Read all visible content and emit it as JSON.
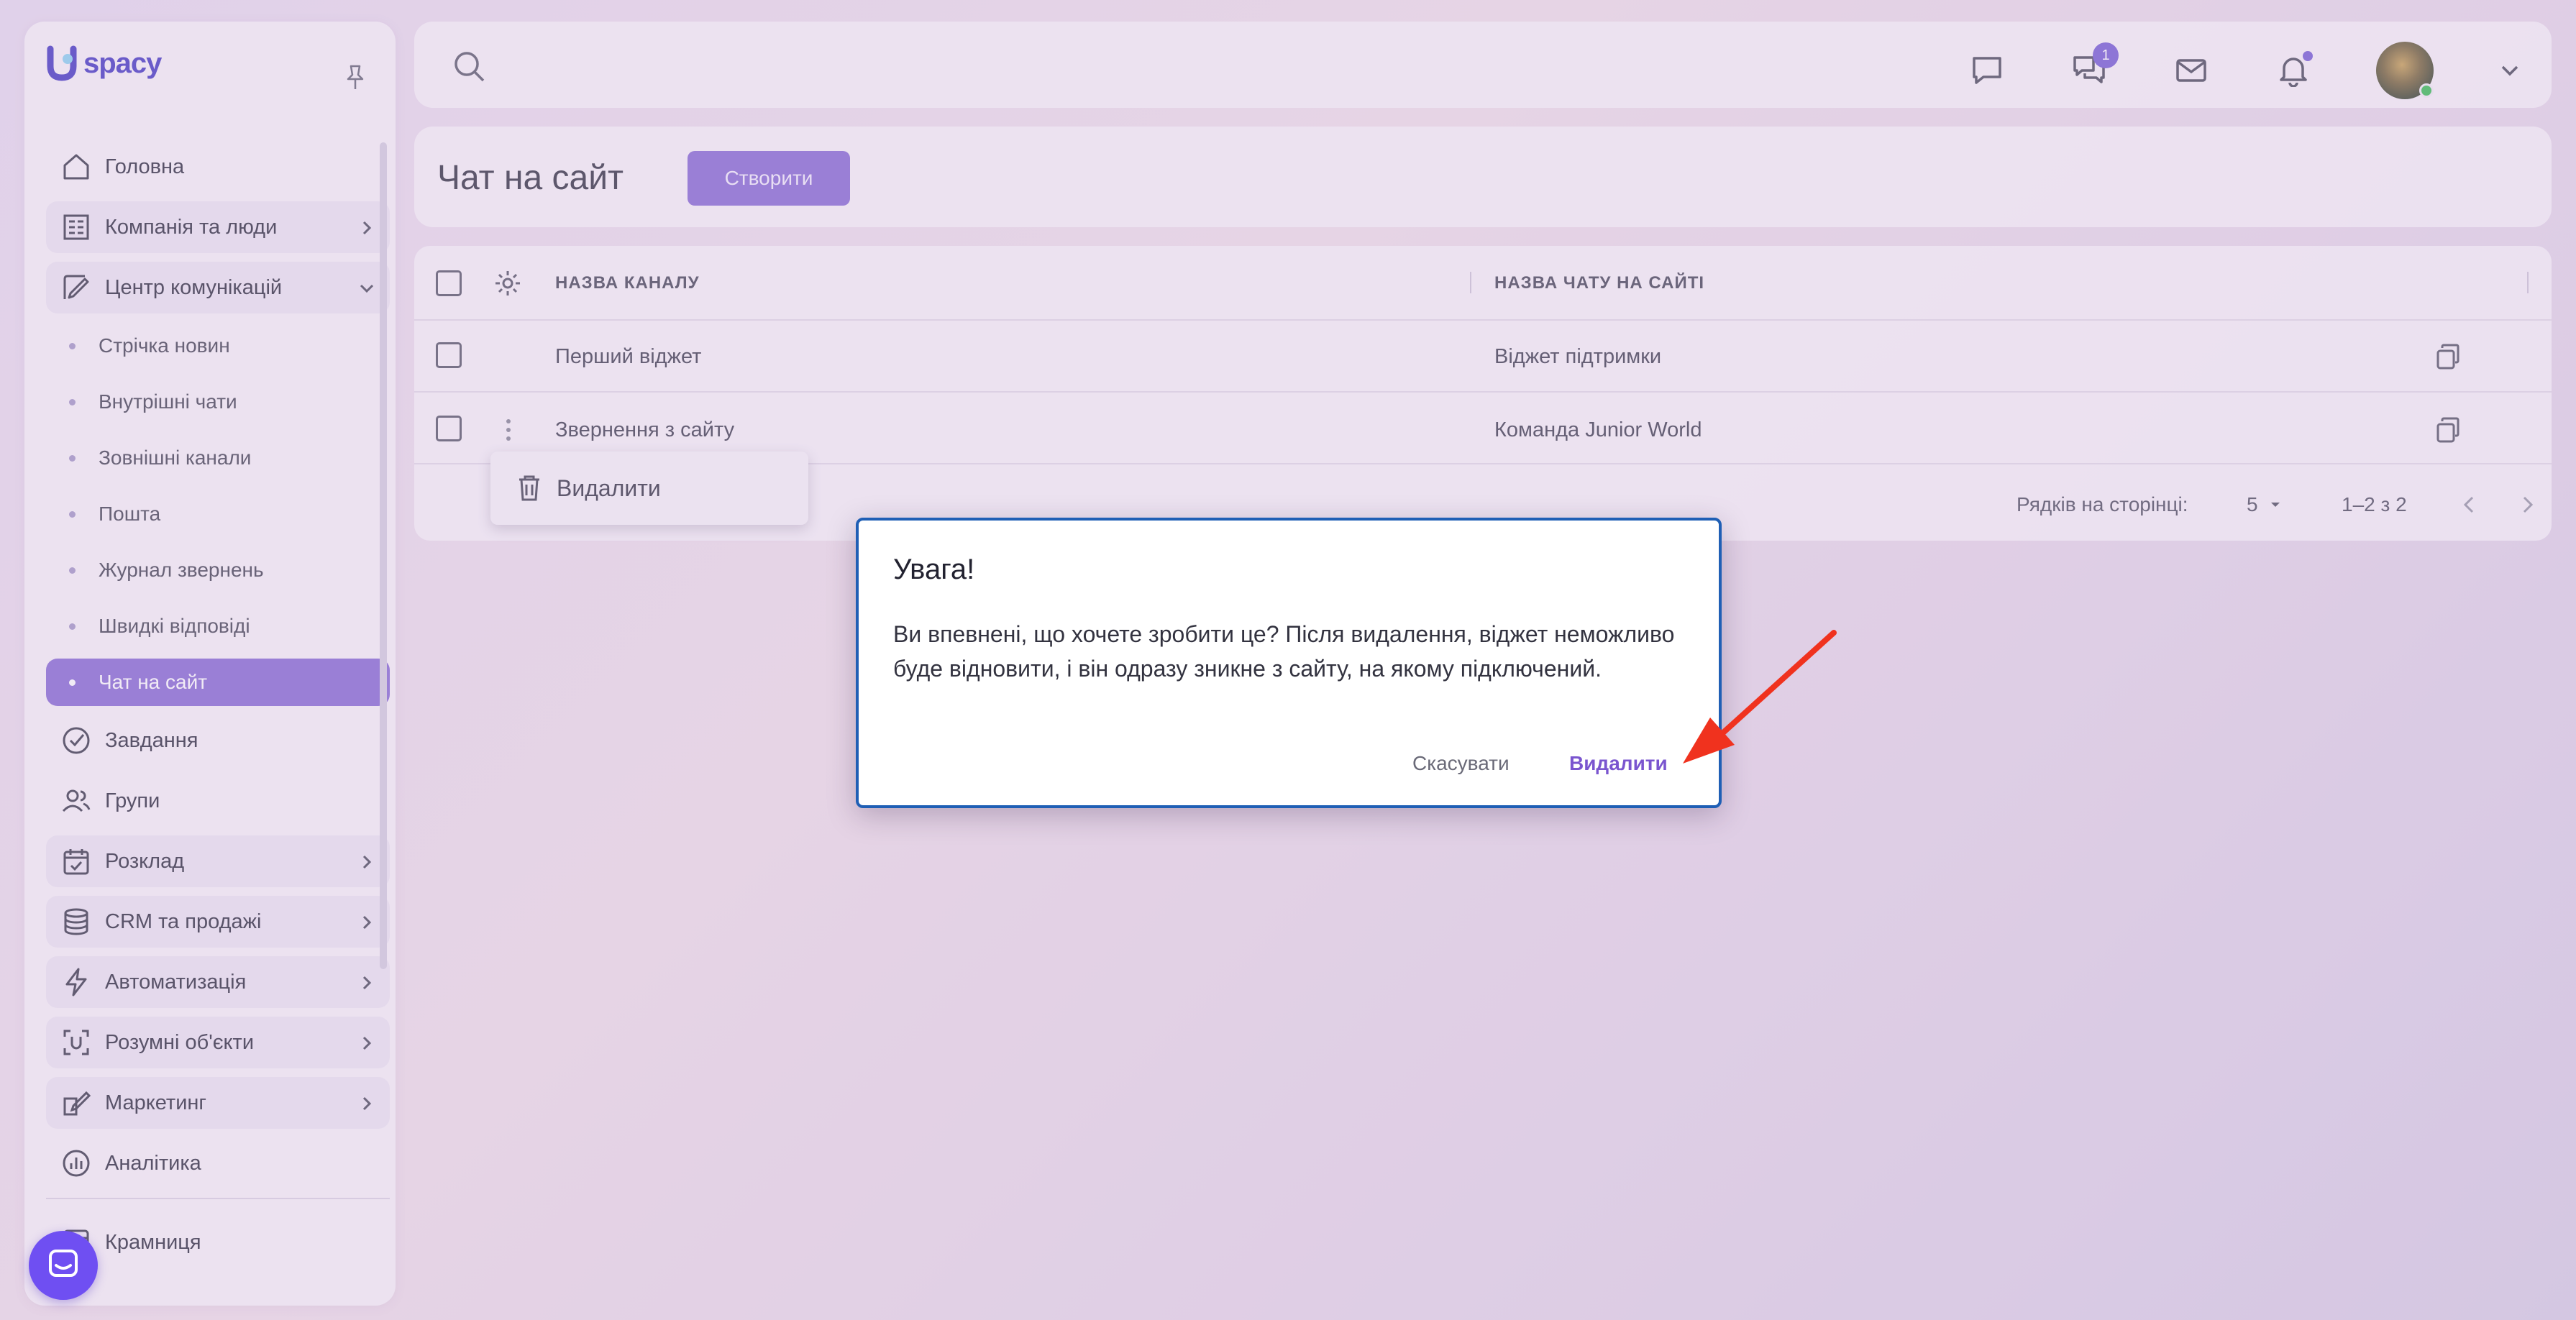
{
  "app": {
    "logo_text": "spacy",
    "brand_color": "#4b3fc5",
    "accent_color": "#8b6fd6"
  },
  "sidebar": {
    "items": [
      {
        "label": "Головна",
        "icon": "home-icon",
        "expandable": false
      },
      {
        "label": "Компанія та люди",
        "icon": "building-icon",
        "expandable": true
      },
      {
        "label": "Центр комунікацій",
        "icon": "communications-icon",
        "expandable": true,
        "expanded": true
      },
      {
        "label": "Завдання",
        "icon": "task-check-icon",
        "expandable": false
      },
      {
        "label": "Групи",
        "icon": "groups-icon",
        "expandable": false
      },
      {
        "label": "Розклад",
        "icon": "calendar-icon",
        "expandable": true
      },
      {
        "label": "CRM та продажі",
        "icon": "database-icon",
        "expandable": true
      },
      {
        "label": "Автоматизація",
        "icon": "lightning-icon",
        "expandable": true
      },
      {
        "label": "Розумні об'єкти",
        "icon": "smart-object-icon",
        "expandable": true
      },
      {
        "label": "Маркетинг",
        "icon": "marketing-icon",
        "expandable": true
      },
      {
        "label": "Аналітика",
        "icon": "analytics-icon",
        "expandable": false
      },
      {
        "label": "Крамниця",
        "icon": "store-icon",
        "expandable": false
      }
    ],
    "sub_items": [
      {
        "label": "Стрічка новин",
        "active": false
      },
      {
        "label": "Внутрішні чати",
        "active": false
      },
      {
        "label": "Зовнішні канали",
        "active": false
      },
      {
        "label": "Пошта",
        "active": false
      },
      {
        "label": "Журнал звернень",
        "active": false
      },
      {
        "label": "Швидкі відповіді",
        "active": false
      },
      {
        "label": "Чат на сайт",
        "active": true
      }
    ]
  },
  "topbar": {
    "chat_badge": "1"
  },
  "page": {
    "title": "Чат на сайт",
    "create_label": "Створити"
  },
  "table": {
    "columns": [
      "НАЗВА КАНАЛУ",
      "НАЗВА ЧАТУ НА САЙТІ"
    ],
    "rows": [
      {
        "channel": "Перший віджет",
        "chat": "Віджет підтримки"
      },
      {
        "channel": "Звернення з сайту",
        "chat": "Команда Junior World"
      }
    ],
    "pager": {
      "rows_label": "Рядків на сторінці:",
      "rows_value": "5",
      "range": "1–2 з 2"
    }
  },
  "context_menu": {
    "delete_label": "Видалити"
  },
  "dialog": {
    "title": "Увага!",
    "message": "Ви впевнені, що хочете зробити це? Після видалення, віджет неможливо буде відновити, і він одразу зникне з сайту, на якому підключений.",
    "cancel_label": "Скасувати",
    "confirm_label": "Видалити",
    "border_color": "#1f5fb5",
    "confirm_color": "#7a55cf"
  },
  "annotation": {
    "arrow_color": "#f0321e"
  },
  "launcher": {
    "color": "#6f4ff2",
    "icon": "chat-launcher-icon"
  }
}
